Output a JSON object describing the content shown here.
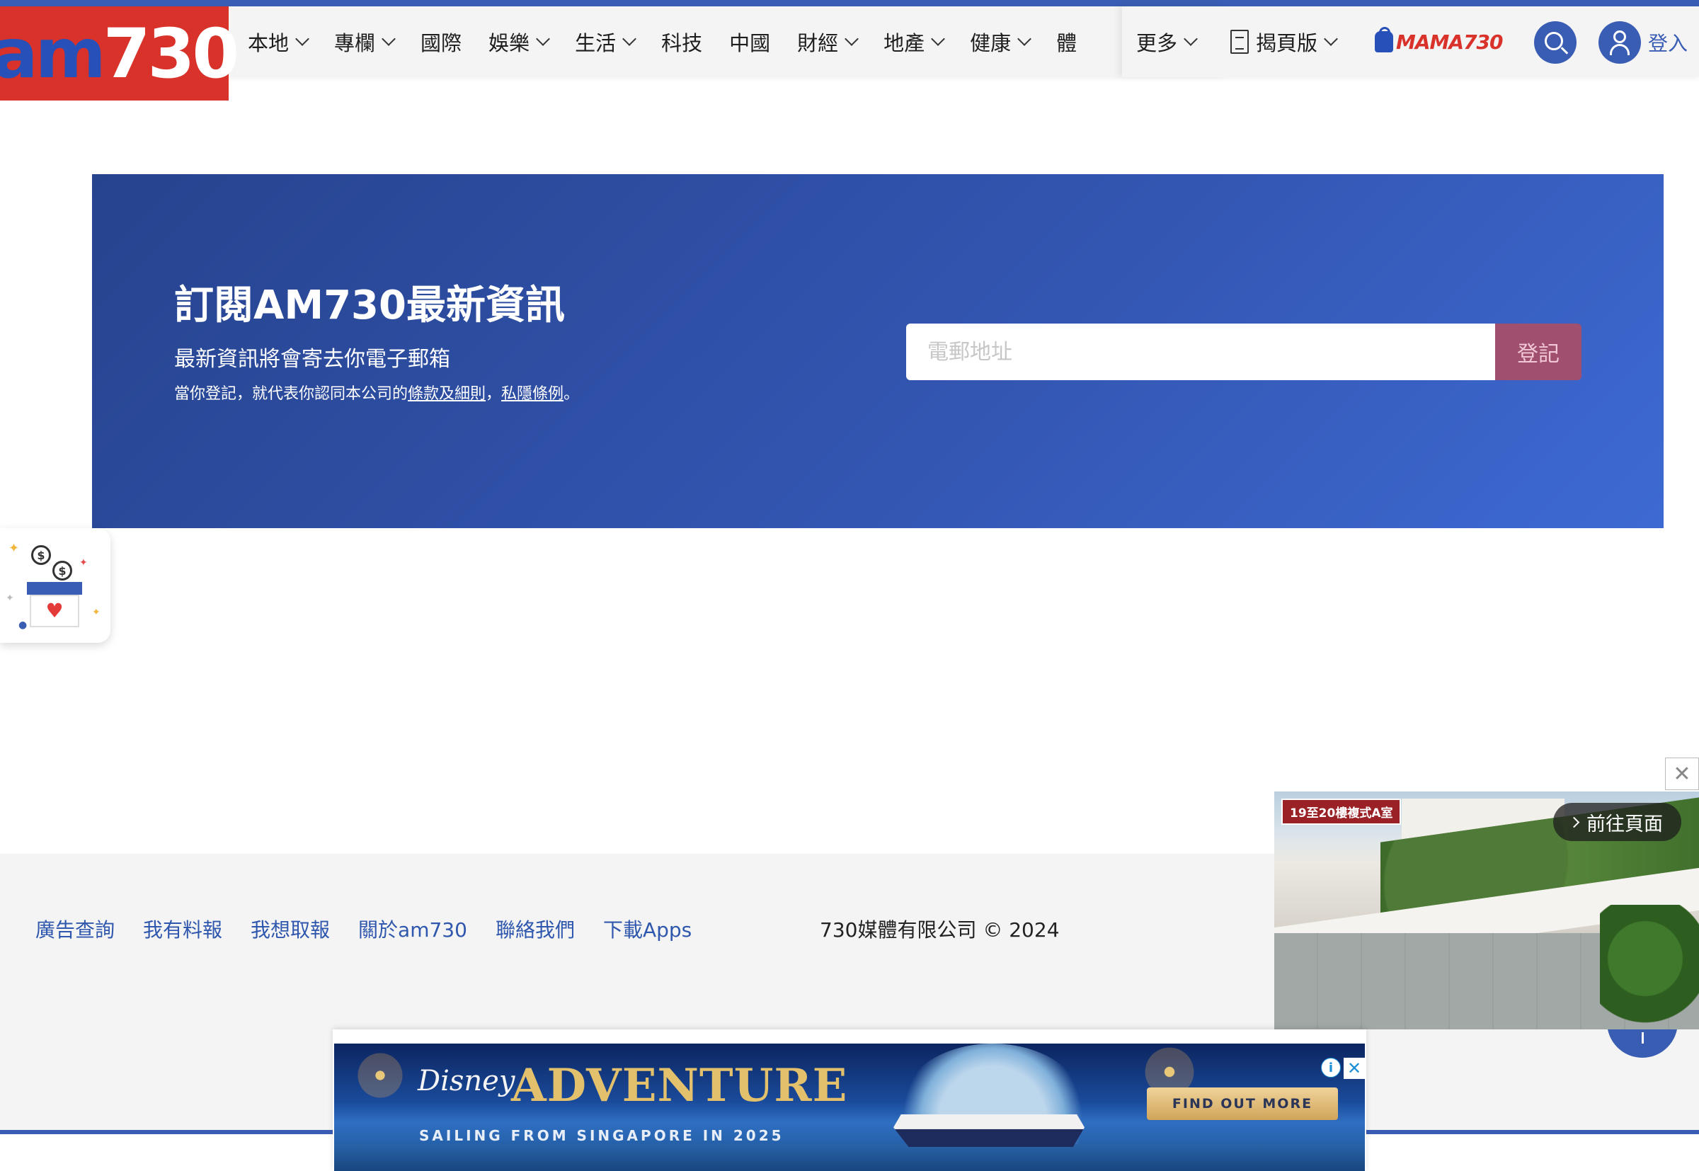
{
  "brand": {
    "logo_am": "am",
    "logo_num": "730",
    "primary_color": "#3a5db4",
    "logo_color": "#d8322a"
  },
  "nav": {
    "items": [
      {
        "label": "本地",
        "dropdown": true
      },
      {
        "label": "專欄",
        "dropdown": true
      },
      {
        "label": "國際",
        "dropdown": false
      },
      {
        "label": "娛樂",
        "dropdown": true
      },
      {
        "label": "生活",
        "dropdown": true
      },
      {
        "label": "科技",
        "dropdown": false
      },
      {
        "label": "中國",
        "dropdown": false
      },
      {
        "label": "財經",
        "dropdown": true
      },
      {
        "label": "地產",
        "dropdown": true
      },
      {
        "label": "健康",
        "dropdown": true
      },
      {
        "label": "體",
        "dropdown": false
      }
    ],
    "more": "更多",
    "epaper": "揭頁版",
    "mama": "MAMA730",
    "login": "登入"
  },
  "subscribe": {
    "title": "訂閱AM730最新資訊",
    "subtitle": "最新資訊將會寄去你電子郵箱",
    "terms_prefix": "當你登記，就代表你認同本公司的",
    "terms_link": "條款及細則",
    "terms_sep": "，",
    "privacy_link": "私隱條例",
    "terms_suffix": "。",
    "email_placeholder": "電郵地址",
    "button": "登記",
    "button_color": "#a0506e"
  },
  "footer": {
    "links": [
      "廣告查詢",
      "我有料報",
      "我想取報",
      "關於am730",
      "聯絡我們",
      "下載Apps"
    ],
    "copyright": "730媒體有限公司 © 2024"
  },
  "video_ad": {
    "tag": "19至20樓複式A室",
    "go_label": "前往頁面",
    "close": "✕"
  },
  "banner_ad": {
    "brand": "Disney",
    "headline": "ADVENTURE",
    "tagline": "SAILING FROM SINGAPORE IN 2025",
    "cta": "FIND OUT MORE",
    "info": "i",
    "close": "✕"
  },
  "donate": {
    "coin_symbol": "$"
  }
}
